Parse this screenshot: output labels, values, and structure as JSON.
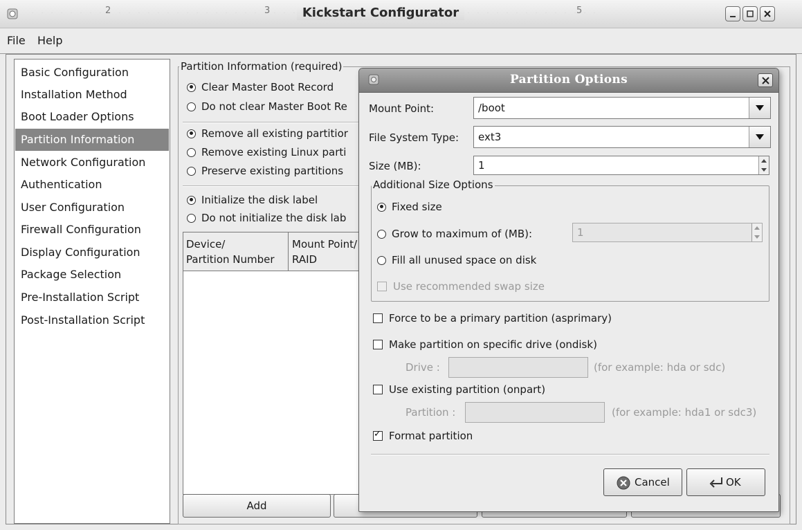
{
  "window": {
    "title": "Kickstart Configurator",
    "ruler_marks": [
      "2",
      "3",
      "5"
    ]
  },
  "menu": {
    "file": "File",
    "help": "Help"
  },
  "sidebar": {
    "items": [
      {
        "label": "Basic Configuration"
      },
      {
        "label": "Installation Method"
      },
      {
        "label": "Boot Loader Options"
      },
      {
        "label": "Partition Information",
        "selected": true
      },
      {
        "label": "Network Configuration"
      },
      {
        "label": "Authentication"
      },
      {
        "label": "User Configuration"
      },
      {
        "label": "Firewall Configuration"
      },
      {
        "label": "Display Configuration"
      },
      {
        "label": "Package Selection"
      },
      {
        "label": "Pre-Installation Script"
      },
      {
        "label": "Post-Installation Script"
      }
    ]
  },
  "partition_info": {
    "group_title": "Partition Information (required)",
    "mbr": {
      "clear": "Clear Master Boot Record",
      "dont_clear": "Do not clear Master Boot Re",
      "selected": "clear"
    },
    "existing": {
      "remove_all": "Remove all existing partitior",
      "remove_linux": "Remove existing Linux parti",
      "preserve": "Preserve existing partitions",
      "selected": "remove_all"
    },
    "disk_label": {
      "init": "Initialize the disk label",
      "dont_init": "Do not initialize the disk lab",
      "selected": "init"
    },
    "table": {
      "col1": "Device/\nPartition Number",
      "col2": "Mount Point/\nRAID"
    },
    "add_button": "Add"
  },
  "dialog": {
    "title": "Partition Options",
    "mount_point_label": "Mount Point:",
    "mount_point_value": "/boot",
    "fs_type_label": "File System Type:",
    "fs_type_value": "ext3",
    "size_label": "Size (MB):",
    "size_value": "1",
    "additional_title": "Additional Size Options",
    "fixed_size": "Fixed size",
    "grow_to_max": "Grow to maximum of (MB):",
    "grow_value": "1",
    "fill_all": "Fill all unused space on disk",
    "recommended_swap": "Use recommended swap size",
    "size_option_selected": "fixed",
    "force_primary": "Force to be a primary partition (asprimary)",
    "ondisk": "Make partition on specific drive (ondisk)",
    "drive_label": "Drive :",
    "drive_hint": "(for example: hda or sdc)",
    "onpart": "Use existing partition (onpart)",
    "partition_label": "Partition :",
    "partition_hint": "(for example: hda1 or sdc3)",
    "format_partition": "Format partition",
    "format_checked": true,
    "cancel_button": "Cancel",
    "ok_button": "OK"
  }
}
